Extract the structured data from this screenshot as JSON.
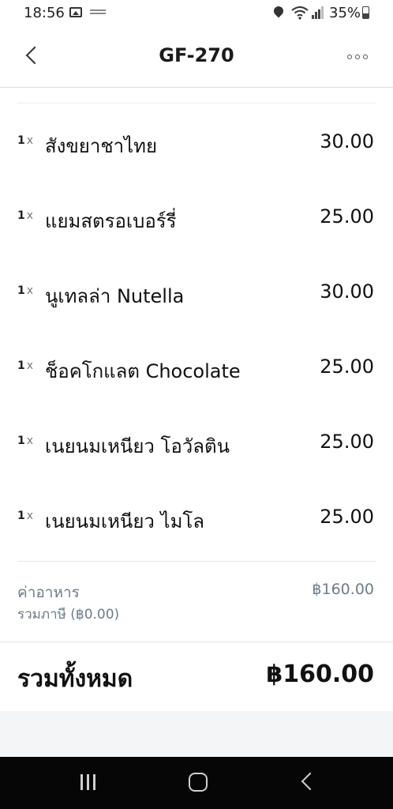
{
  "status_bar": {
    "time": "18:56",
    "battery_percent": "35%",
    "icons": [
      "gallery-icon",
      "app-notification-icon",
      "location-icon",
      "wifi-icon",
      "signal-icon",
      "battery-icon"
    ]
  },
  "header": {
    "title": "GF-270",
    "back_icon": "chevron-left-icon",
    "more_icon": "more-options-icon"
  },
  "order_items": [
    {
      "qty": "1",
      "x": "x",
      "name": "สังขยาชาไทย",
      "price": "30.00"
    },
    {
      "qty": "1",
      "x": "x",
      "name": "แยมสตรอเบอร์รี่",
      "price": "25.00"
    },
    {
      "qty": "1",
      "x": "x",
      "name": "นูเทลล่า Nutella",
      "price": "30.00"
    },
    {
      "qty": "1",
      "x": "x",
      "name": "ช็อคโกแลต Chocolate",
      "price": "25.00"
    },
    {
      "qty": "1",
      "x": "x",
      "name": "เนยนมเหนียว โอวัลติน",
      "price": "25.00"
    },
    {
      "qty": "1",
      "x": "x",
      "name": "เนยนมเหนียว ไมโล",
      "price": "25.00"
    }
  ],
  "summary": {
    "food_label": "ค่าอาหาร",
    "food_amount": "฿160.00",
    "tax_label": "รวมภาษี (฿0.00)",
    "total_label": "รวมทั้งหมด",
    "total_amount": "฿160.00"
  },
  "nav_bar": {
    "icons": [
      "recents-icon",
      "home-icon",
      "back-icon"
    ]
  }
}
